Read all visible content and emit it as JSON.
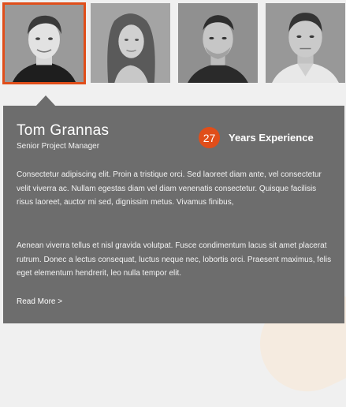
{
  "team": {
    "members": [
      {
        "photo_alt": "Tom Grannas portrait",
        "active": true
      },
      {
        "photo_alt": "Team member portrait",
        "active": false
      },
      {
        "photo_alt": "Team member portrait",
        "active": false
      },
      {
        "photo_alt": "Team member portrait",
        "active": false
      }
    ]
  },
  "profile": {
    "name": "Tom Grannas",
    "role": "Senior Project Manager",
    "years_value": "27",
    "years_label": "Years Experience",
    "paragraph_1": "Consectetur adipiscing elit. Proin a tristique orci. Sed laoreet diam ante, vel consectetur velit viverra ac. Nullam egestas diam vel diam venenatis consectetur. Quisque facilisis risus laoreet, auctor mi sed, dignissim metus. Vivamus finibus,",
    "paragraph_2": "Aenean viverra tellus et nisl gravida volutpat. Fusce condimentum lacus sit amet placerat rutrum. Donec a lectus consequat, luctus neque nec, lobortis orci. Praesent maximus, felis eget elementum hendrerit, leo nulla tempor elit.",
    "read_more": "Read More >"
  },
  "colors": {
    "accent": "#e04e1a",
    "panel": "#6d6d6d",
    "background": "#f0f0f0"
  }
}
